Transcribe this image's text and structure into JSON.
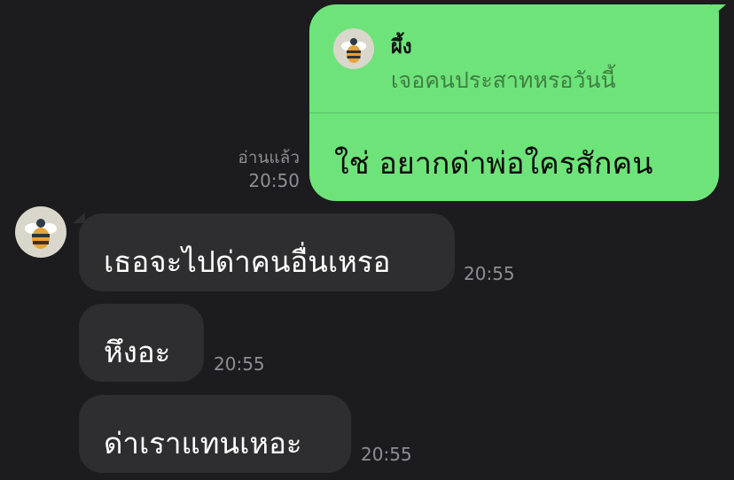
{
  "quoted": {
    "sender": "ผึ้ง",
    "text": "เจอคนประสาทหรอวันนี้"
  },
  "sent_message": {
    "text": "ใช่ อยากด่าพ่อใครสักคน",
    "read_label": "อ่านแล้ว",
    "time": "20:50"
  },
  "received_messages": [
    {
      "text": "เธอจะไปด่าคนอื่นเหรอ",
      "time": "20:55"
    },
    {
      "text": "หึงอะ",
      "time": "20:55"
    },
    {
      "text": "ด่าเราแทนเหอะ",
      "time": "20:55"
    }
  ],
  "colors": {
    "background": "#1c1c1e",
    "sent_bubble": "#6ee379",
    "received_bubble": "#2e2e30",
    "timestamp": "#8e8e93"
  },
  "icons": {
    "avatar": "bee-avatar-icon"
  }
}
